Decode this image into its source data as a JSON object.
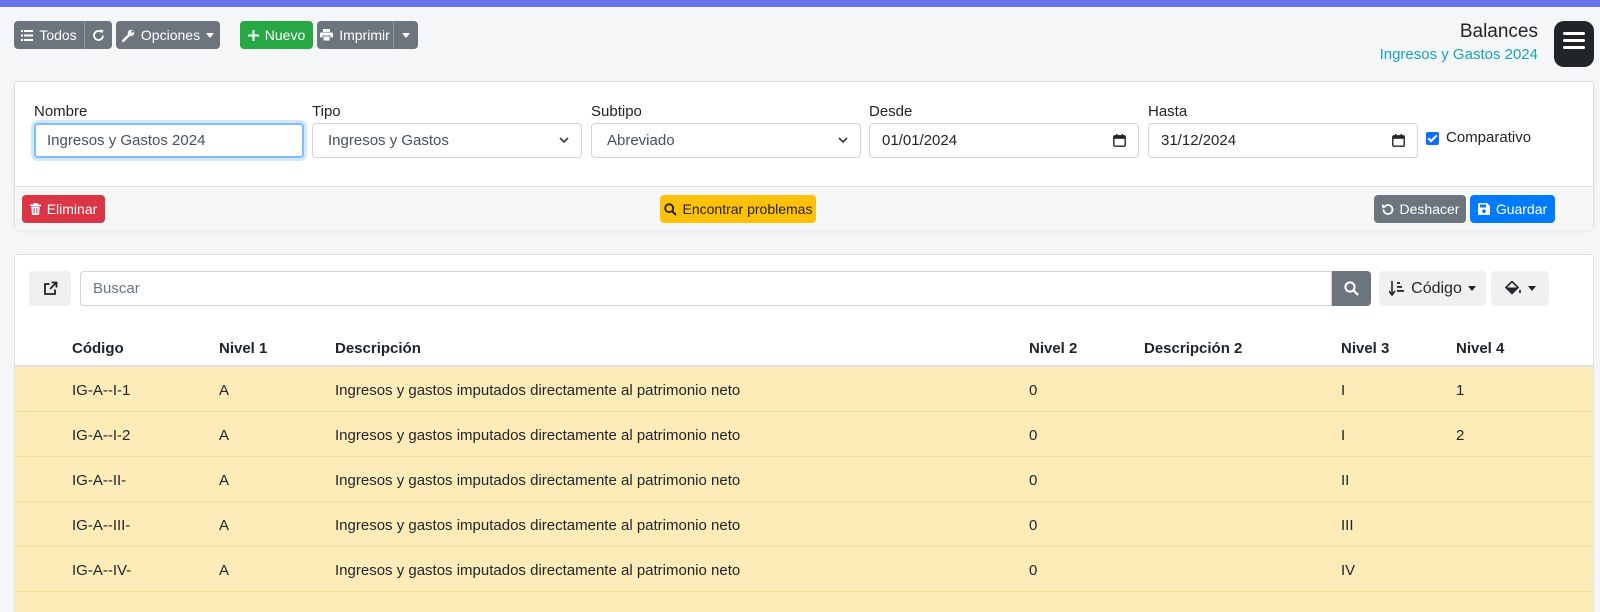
{
  "toolbar": {
    "todos": "Todos",
    "opciones": "Opciones",
    "nuevo": "Nuevo",
    "imprimir": "Imprimir"
  },
  "header": {
    "title": "Balances",
    "subtitle": "Ingresos y Gastos 2024"
  },
  "form": {
    "nombre_label": "Nombre",
    "nombre_value": "Ingresos y Gastos 2024",
    "tipo_label": "Tipo",
    "tipo_value": "Ingresos y Gastos",
    "subtipo_label": "Subtipo",
    "subtipo_value": "Abreviado",
    "desde_label": "Desde",
    "desde_value": "01/01/2024",
    "hasta_label": "Hasta",
    "hasta_value": "31/12/2024",
    "comparativo_label": "Comparativo",
    "comparativo_checked": true
  },
  "actions": {
    "eliminar": "Eliminar",
    "encontrar": "Encontrar problemas",
    "deshacer": "Deshacer",
    "guardar": "Guardar"
  },
  "list": {
    "search_placeholder": "Buscar",
    "sort_label": "Código",
    "columns": [
      "Código",
      "Nivel 1",
      "Descripción",
      "Nivel 2",
      "Descripción 2",
      "Nivel 3",
      "Nivel 4"
    ],
    "rows": [
      [
        "IG-A--I-1",
        "A",
        "Ingresos y gastos imputados directamente al patrimonio neto",
        "0",
        "",
        "I",
        "1"
      ],
      [
        "IG-A--I-2",
        "A",
        "Ingresos y gastos imputados directamente al patrimonio neto",
        "0",
        "",
        "I",
        "2"
      ],
      [
        "IG-A--II-",
        "A",
        "Ingresos y gastos imputados directamente al patrimonio neto",
        "0",
        "",
        "II",
        ""
      ],
      [
        "IG-A--III-",
        "A",
        "Ingresos y gastos imputados directamente al patrimonio neto",
        "0",
        "",
        "III",
        ""
      ],
      [
        "IG-A--IV-",
        "A",
        "Ingresos y gastos imputados directamente al patrimonio neto",
        "0",
        "",
        "IV",
        ""
      ]
    ]
  },
  "colors": {
    "accent_bar": "#6673e6",
    "row_highlight": "#fdebb8",
    "subtitle": "#17a2b8"
  }
}
